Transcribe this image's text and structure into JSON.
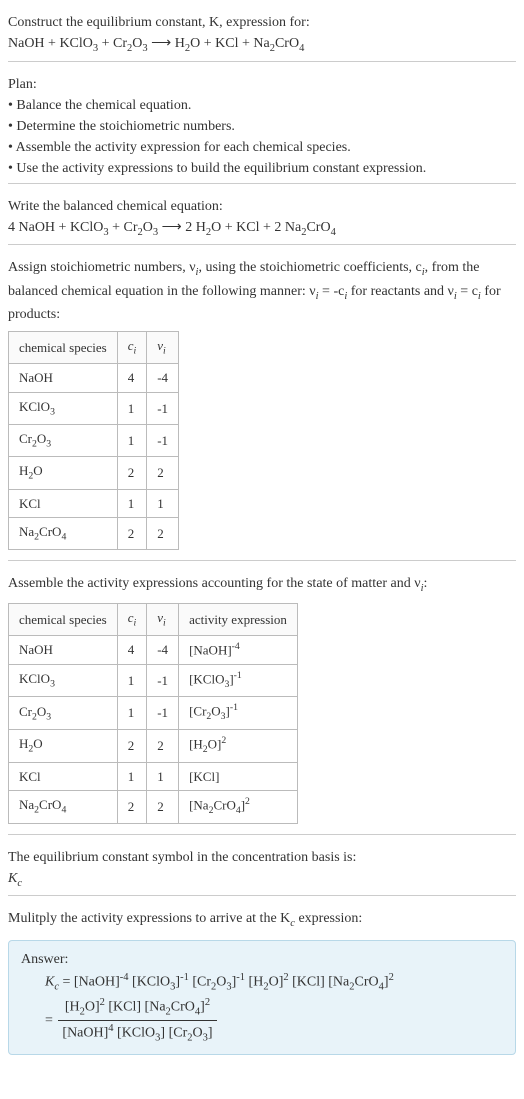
{
  "intro": {
    "line1": "Construct the equilibrium constant, K, expression for:",
    "eq_lhs1": "NaOH + KClO",
    "eq_lhs2": " + Cr",
    "eq_lhs3": "O",
    "arrow": " ⟶ ",
    "eq_rhs1": "H",
    "eq_rhs2": "O + KCl + Na",
    "eq_rhs3": "CrO"
  },
  "plan": {
    "title": "Plan:",
    "b1": "• Balance the chemical equation.",
    "b2": "• Determine the stoichiometric numbers.",
    "b3": "• Assemble the activity expression for each chemical species.",
    "b4": "• Use the activity expressions to build the equilibrium constant expression."
  },
  "balanced": {
    "title": "Write the balanced chemical equation:",
    "lhs1": "4 NaOH + KClO",
    "lhs2": " + Cr",
    "lhs3": "O",
    "arrow": " ⟶ ",
    "rhs1": "2 H",
    "rhs2": "O + KCl + 2 Na",
    "rhs3": "CrO"
  },
  "assign": {
    "text1": "Assign stoichiometric numbers, ν",
    "text2": ", using the stoichiometric coefficients, c",
    "text3": ", from the balanced chemical equation in the following manner: ν",
    "text4": " = -c",
    "text5": " for reactants and ν",
    "text6": " = c",
    "text7": " for products:"
  },
  "table1": {
    "h1": "chemical species",
    "h2": "c",
    "h3": "ν",
    "rows": [
      {
        "sp": "NaOH",
        "c": "4",
        "v": "-4",
        "sub": ""
      },
      {
        "sp": "KClO",
        "c": "1",
        "v": "-1",
        "sub": "3"
      },
      {
        "sp": "Cr",
        "c": "1",
        "v": "-1",
        "sub": "2",
        "sp2": "O",
        "sub2": "3"
      },
      {
        "sp": "H",
        "c": "2",
        "v": "2",
        "sub": "2",
        "sp2": "O",
        "sub2": ""
      },
      {
        "sp": "KCl",
        "c": "1",
        "v": "1",
        "sub": ""
      },
      {
        "sp": "Na",
        "c": "2",
        "v": "2",
        "sub": "2",
        "sp2": "CrO",
        "sub2": "4"
      }
    ]
  },
  "assemble": {
    "text1": "Assemble the activity expressions accounting for the state of matter and ν",
    "text2": ":"
  },
  "table2": {
    "h1": "chemical species",
    "h2": "c",
    "h3": "ν",
    "h4": "activity expression",
    "rows": [
      {
        "sp": "NaOH",
        "sub": "",
        "sp2": "",
        "sub2": "",
        "c": "4",
        "v": "-4",
        "ae": "[NaOH]",
        "exp": "-4"
      },
      {
        "sp": "KClO",
        "sub": "3",
        "sp2": "",
        "sub2": "",
        "c": "1",
        "v": "-1",
        "ae": "[KClO",
        "aesub": "3",
        "ae2": "]",
        "exp": "-1"
      },
      {
        "sp": "Cr",
        "sub": "2",
        "sp2": "O",
        "sub2": "3",
        "c": "1",
        "v": "-1",
        "ae": "[Cr",
        "aesub": "2",
        "ae2": "O",
        "aesub2": "3",
        "ae3": "]",
        "exp": "-1"
      },
      {
        "sp": "H",
        "sub": "2",
        "sp2": "O",
        "sub2": "",
        "c": "2",
        "v": "2",
        "ae": "[H",
        "aesub": "2",
        "ae2": "O]",
        "exp": "2"
      },
      {
        "sp": "KCl",
        "sub": "",
        "sp2": "",
        "sub2": "",
        "c": "1",
        "v": "1",
        "ae": "[KCl]",
        "exp": ""
      },
      {
        "sp": "Na",
        "sub": "2",
        "sp2": "CrO",
        "sub2": "4",
        "c": "2",
        "v": "2",
        "ae": "[Na",
        "aesub": "2",
        "ae2": "CrO",
        "aesub2": "4",
        "ae3": "]",
        "exp": "2"
      }
    ]
  },
  "symbol": {
    "text": "The equilibrium constant symbol in the concentration basis is:",
    "k": "K",
    "sub": "c"
  },
  "multiply": {
    "text1": "Mulitply the activity expressions to arrive at the K",
    "text2": " expression:"
  },
  "answer": {
    "label": "Answer:",
    "kc": "K",
    "eq": " = [NaOH]",
    "t1": " [KClO",
    "t2": "]",
    "t3": " [Cr",
    "t4": "O",
    "t5": "]",
    "t6": " [H",
    "t7": "O]",
    "t8": " [KCl] [Na",
    "t9": "CrO",
    "t10": "]",
    "num1": "[H",
    "num2": "O]",
    "num3": " [KCl] [Na",
    "num4": "CrO",
    "num5": "]",
    "den1": "[NaOH]",
    "den2": " [KClO",
    "den3": "] [Cr",
    "den4": "O",
    "den5": "]"
  },
  "n": {
    "2": "2",
    "3": "3",
    "4": "4",
    "c": "c",
    "i": "i",
    "m4": "-4",
    "m1": "-1"
  }
}
